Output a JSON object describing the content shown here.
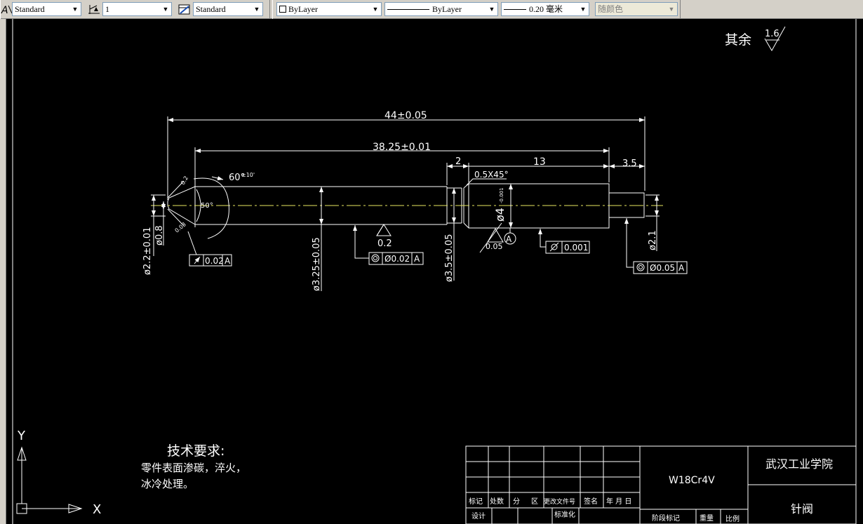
{
  "toolbar": {
    "text_style": "Standard",
    "dim_scale": "1",
    "dim_style": "Standard",
    "layer": "ByLayer",
    "linetype": "ByLayer",
    "lineweight": "0.20 毫米",
    "color": "随颜色"
  },
  "drawing": {
    "roughness_prefix": "其余",
    "roughness_value": "1.6",
    "dims": {
      "overall": "44±0.05",
      "length_main": "38.25±0.01",
      "groove": "2",
      "head": "13",
      "tail": "3.5",
      "chamfer": "0.5X45°",
      "angle_60": "60°",
      "angle_60_tol": "±10'",
      "angle_50": "50°",
      "tip_small_a": "0.2",
      "tip_small_b": "0.03",
      "dia_2_2": "ø2.2±0.01",
      "dia_0_8": "ø0.8",
      "dia_3_25": "ø3.25±0.05",
      "dia_3_5": "ø3.5±0.05",
      "dia_4": "ø4",
      "dia_4_tol": "-0.001",
      "dia_2_1": "ø2.1"
    },
    "gdt": {
      "runout_value": "0.02",
      "runout_datum": "A",
      "conc1_value": "Ø0.02",
      "conc1_datum": "A",
      "cyl_value": "0.001",
      "conc2_value": "Ø0.05",
      "conc2_datum": "A",
      "datum_label": "A"
    },
    "rough": {
      "r1": "0.2",
      "r2": "0.05"
    },
    "notes": {
      "title": "技术要求:",
      "line1": "零件表面渗碳，淬火，",
      "line2": "冰冷处理。"
    },
    "ucs": {
      "x": "X",
      "y": "Y"
    },
    "title_block": {
      "material": "W18Cr4V",
      "school": "武汉工业学院",
      "part_name": "针阀",
      "h_mark": "标记",
      "h_count": "处数",
      "h_zone_a": "分",
      "h_zone_b": "区",
      "h_doc": "更改文件号",
      "h_sign": "签名",
      "h_date": "年 月 日",
      "h_design": "设计",
      "h_standard": "标准化",
      "h_stage": "阶段标记",
      "h_weight": "重量",
      "h_scale": "比例"
    }
  }
}
